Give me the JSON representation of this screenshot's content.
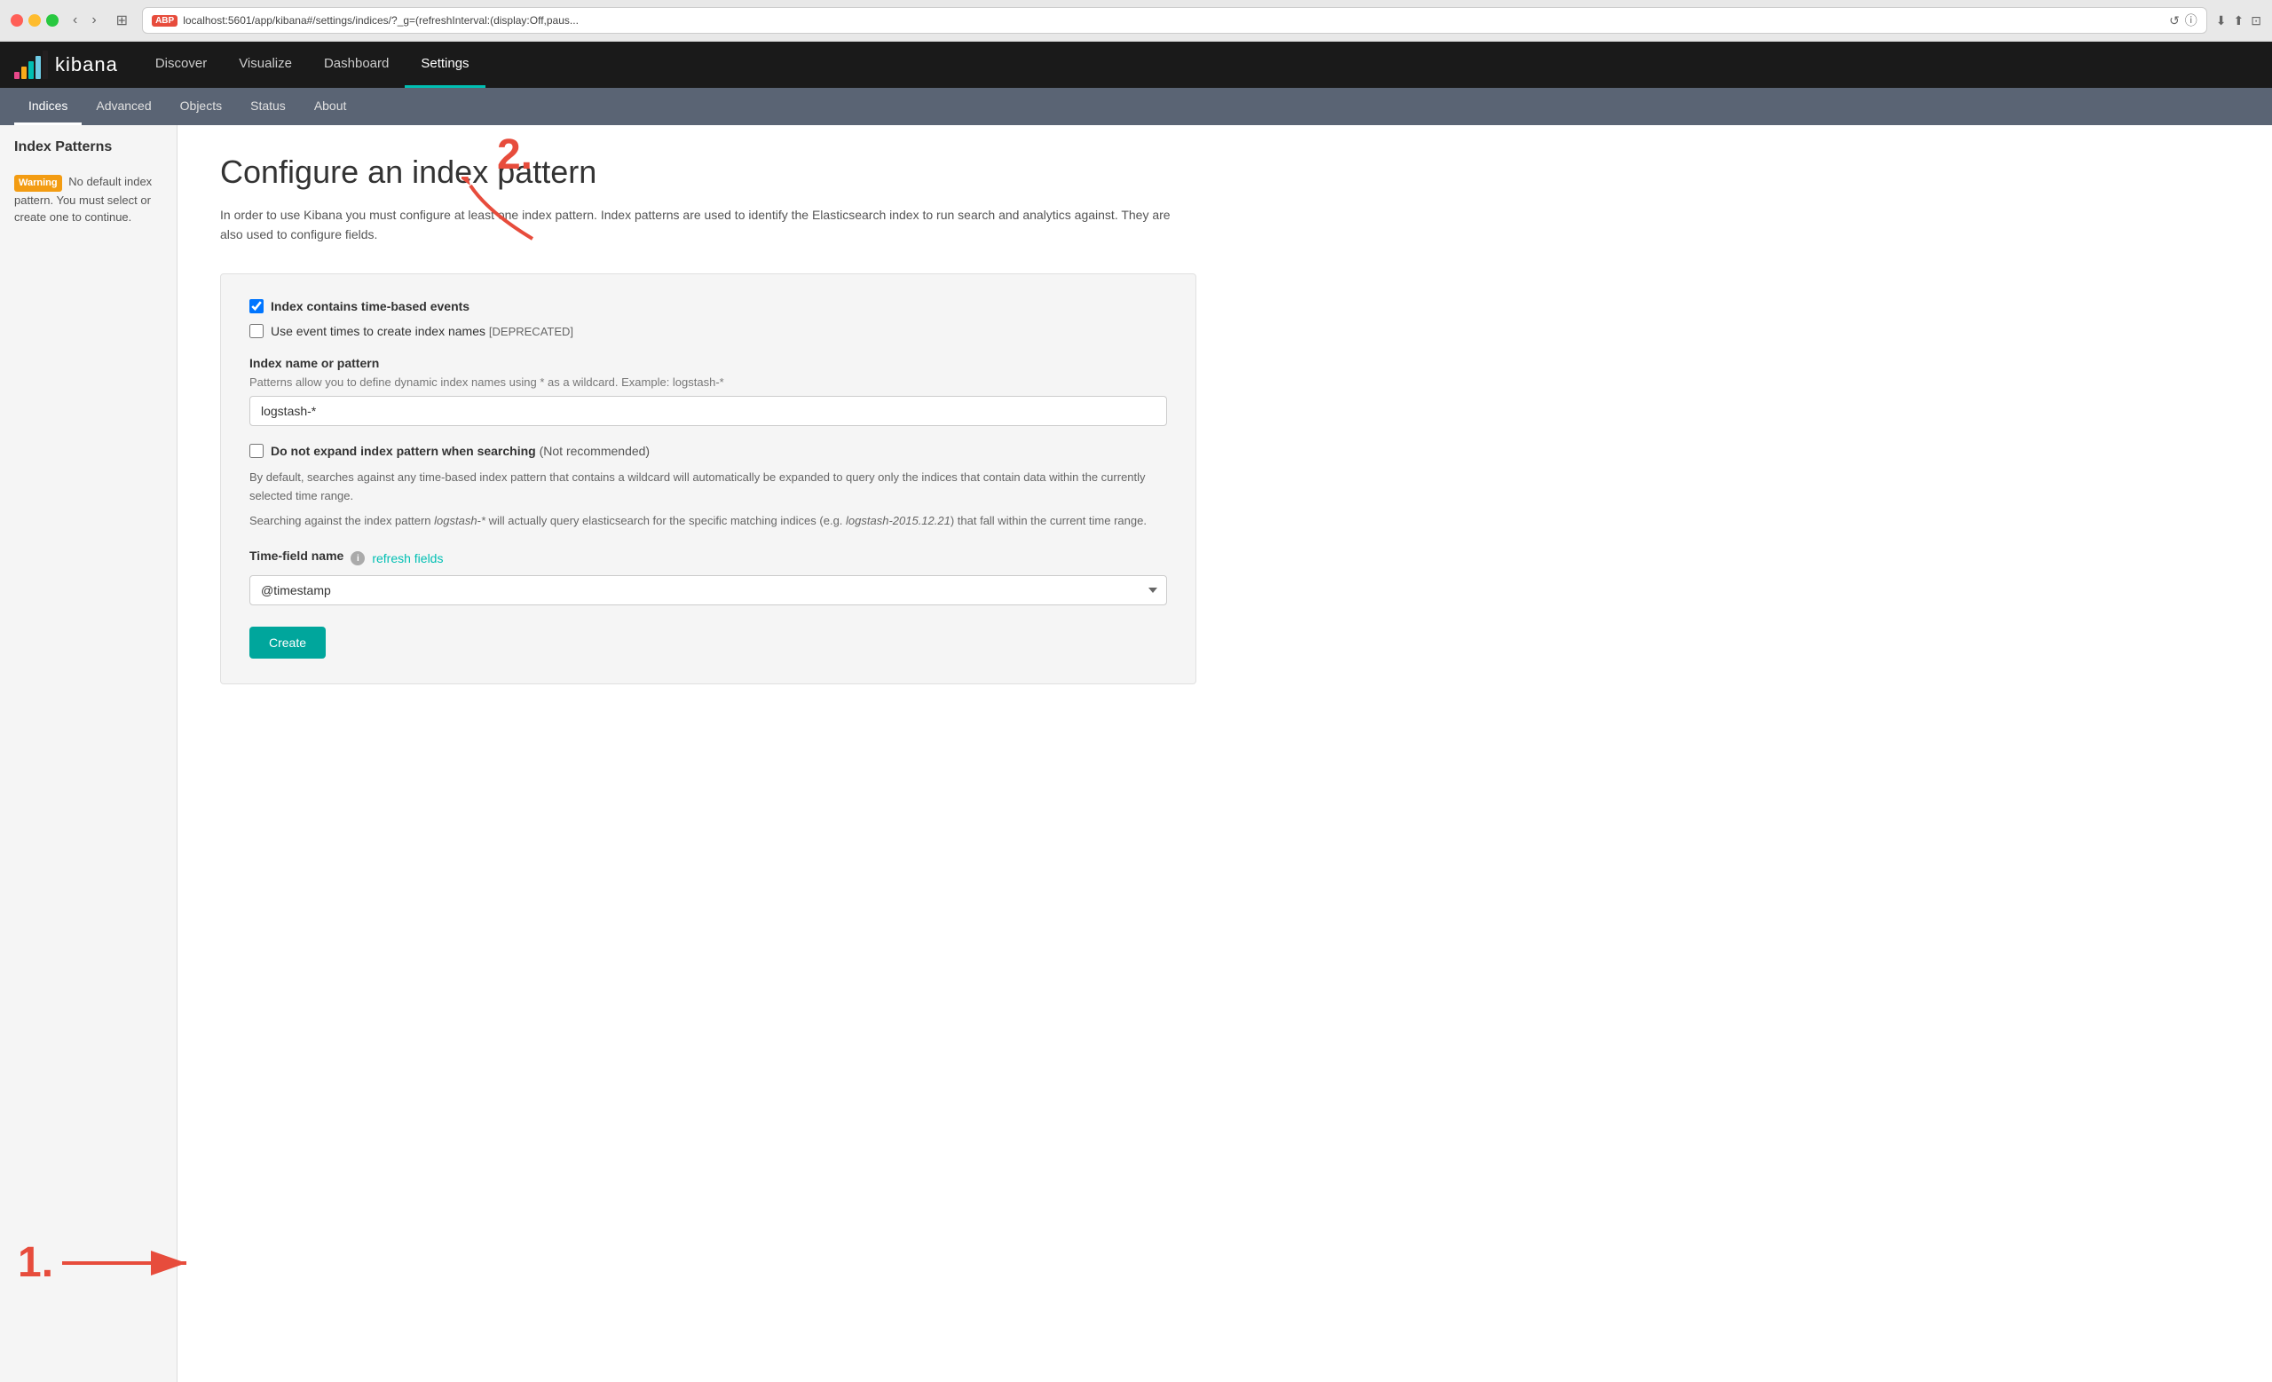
{
  "browser": {
    "traffic_lights": [
      "red",
      "yellow",
      "green"
    ],
    "url": "localhost:5601/app/kibana#/settings/indices/?_g=(refreshInterval:(display:Off,paus...",
    "abp_label": "ABP"
  },
  "app": {
    "logo_text": "kibana",
    "nav_items": [
      {
        "label": "Discover",
        "active": false
      },
      {
        "label": "Visualize",
        "active": false
      },
      {
        "label": "Dashboard",
        "active": false
      },
      {
        "label": "Settings",
        "active": true
      }
    ]
  },
  "subnav": {
    "items": [
      {
        "label": "Indices",
        "active": true
      },
      {
        "label": "Advanced",
        "active": false
      },
      {
        "label": "Objects",
        "active": false
      },
      {
        "label": "Status",
        "active": false
      },
      {
        "label": "About",
        "active": false
      }
    ]
  },
  "sidebar": {
    "title": "Index Patterns",
    "warning_label": "Warning",
    "warning_text": "No default index pattern. You must select or create one to continue."
  },
  "content": {
    "title": "Configure an index pattern",
    "description": "In order to use Kibana you must configure at least one index pattern. Index patterns are used to identify the Elasticsearch index to run search and analytics against. They are also used to configure fields.",
    "checkbox_time": "Index contains time-based events",
    "checkbox_event": "Use event times to create index names",
    "deprecated_tag": "[DEPRECATED]",
    "field_group_label": "Index name or pattern",
    "field_hint": "Patterns allow you to define dynamic index names using * as a wildcard. Example: logstash-*",
    "index_pattern_value": "logstash-*",
    "checkbox_expand": "Do not expand index pattern when searching",
    "not_recommended": "(Not recommended)",
    "expand_desc_1": "By default, searches against any time-based index pattern that contains a wildcard will automatically be expanded to query only the indices that contain data within the currently selected time range.",
    "expand_desc_2_prefix": "Searching against the index pattern ",
    "expand_desc_2_pattern": "logstash-*",
    "expand_desc_2_mid": " will actually query elasticsearch for the specific matching indices (e.g. ",
    "expand_desc_2_example": "logstash-2015.12.21",
    "expand_desc_2_suffix": ") that fall within the current time range.",
    "time_field_label": "Time-field name",
    "refresh_link": "refresh fields",
    "timestamp_value": "@timestamp",
    "create_button": "Create"
  },
  "annotations": {
    "step1": "1.",
    "step2": "2."
  }
}
